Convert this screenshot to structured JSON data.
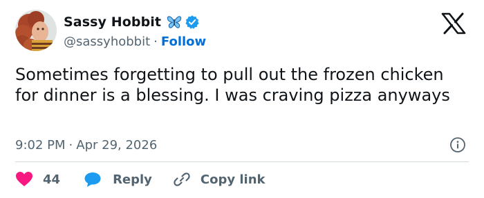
{
  "author": {
    "display_name": "Sassy Hobbit",
    "handle": "@sassyhobbit",
    "separator": "·",
    "follow_label": "Follow",
    "emoji_icon": "butterfly-icon",
    "verified_icon": "verified-badge-icon",
    "avatar_icon": "profile-photo"
  },
  "platform": {
    "logo_icon": "x-logo-icon"
  },
  "tweet": {
    "text": "Sometimes forgetting to pull out the frozen chicken for dinner is a blessing. I was craving pizza anyways",
    "time": "9:02 PM",
    "separator": "·",
    "date": "Apr 29, 2026",
    "info_icon": "info-icon"
  },
  "actions": {
    "like_count": "44",
    "reply_label": "Reply",
    "copy_label": "Copy link"
  },
  "colors": {
    "accent_blue": "#1d9bf0",
    "follow_blue": "#006fd6",
    "like_pink": "#f91880",
    "muted_text": "#536471",
    "primary_text": "#0f1419",
    "divider": "#cfd9de"
  }
}
